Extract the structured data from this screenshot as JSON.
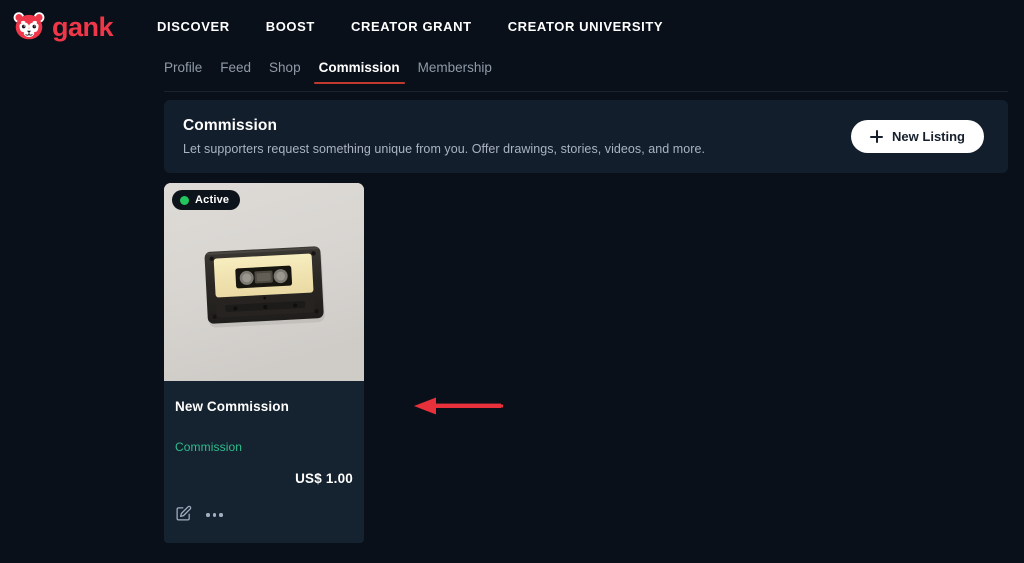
{
  "brand": {
    "word": "gank",
    "logo_icon": "red-panda-logo-icon",
    "color": "#f0374a"
  },
  "topnav": {
    "links": [
      {
        "label": "DISCOVER",
        "name": "nav-link-discover"
      },
      {
        "label": "BOOST",
        "name": "nav-link-boost"
      },
      {
        "label": "CREATOR GRANT",
        "name": "nav-link-creator-grant"
      },
      {
        "label": "CREATOR UNIVERSITY",
        "name": "nav-link-creator-university"
      }
    ]
  },
  "tabs": {
    "items": [
      {
        "label": "Profile",
        "active": false
      },
      {
        "label": "Feed",
        "active": false
      },
      {
        "label": "Shop",
        "active": false
      },
      {
        "label": "Commission",
        "active": true
      },
      {
        "label": "Membership",
        "active": false
      }
    ],
    "active_underline_color": "#c0392f"
  },
  "banner": {
    "title": "Commission",
    "subtitle": "Let supporters request something unique from you. Offer drawings, stories, videos, and more.",
    "button_label": "New Listing",
    "button_icon": "plus-icon",
    "background": "#121e2c"
  },
  "listings": [
    {
      "status_label": "Active",
      "status_color": "#22c55e",
      "thumbnail_alt": "cassette-tape-photo",
      "title": "New Commission",
      "tag": "Commission",
      "tag_color": "#2ebd8e",
      "price": "US$ 1.00",
      "actions": {
        "edit_icon": "edit-pencil-icon",
        "more_icon": "more-options-icon"
      }
    }
  ],
  "annotation": {
    "type": "arrow",
    "direction": "left",
    "color": "#e8313a"
  },
  "theme": {
    "page_background": "#0a1019",
    "card_background": "#15222f",
    "text_primary": "#ffffff",
    "text_muted": "#8f9aa8"
  }
}
